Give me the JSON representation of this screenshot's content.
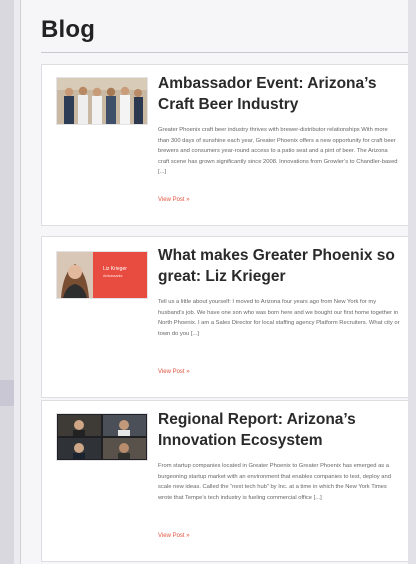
{
  "blog": {
    "title": "Blog",
    "posts": [
      {
        "title": "Ambassador Event: Arizona’s Craft Beer Industry",
        "excerpt": "Greater Phoenix craft beer industry thrives with brewer-distributor relationships With more than 300 days of sunshine each year, Greater Phoenix offers a new opportunity for craft beer brewers and consumers year-round access to a patio seat and a pint of beer. The Arizona craft scene has grown significantly since 2008. Innovations from Growler’s to Chandler-based [...]",
        "link": "View Post »"
      },
      {
        "title": "What makes Greater Phoenix so great: Liz Krieger",
        "excerpt": "Tell us a little about yourself: I moved to Arizona four years ago from New York for my husband’s job. We have one son who was born here and we bought our first home together in North Phoenix. I am a Sales Director for local staffing agency Platform Recruiters. What city or town do you [...]",
        "link": "View Post »",
        "thumb_name": "Liz Krieger",
        "thumb_subtitle": "Ambassador"
      },
      {
        "title": "Regional Report: Arizona’s Innovation Ecosystem",
        "excerpt": "From startup companies located in Greater Phoenix to Greater Phoenix has emerged as a burgeoning startup market with an environment that enables companies to test, deploy and scale new ideas. Called the “next tech hub” by Inc. at a time in which the New York Times wrote that Tempe’s tech industry is fueling commercial office [...]",
        "link": "View Post »"
      }
    ]
  },
  "colors": {
    "accent": "#e0533e",
    "thumb2_bg": "#e84b3f"
  }
}
